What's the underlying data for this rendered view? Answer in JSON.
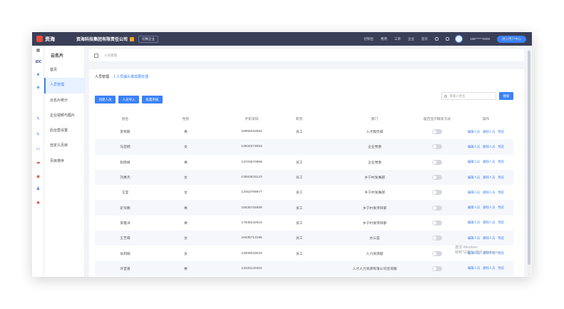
{
  "topbar": {
    "logo_text": "资海",
    "company": "资海科技集团有限责任公司",
    "switch_label": "切换企业",
    "nav": [
      "控制台",
      "费用",
      "工单",
      "企业",
      "首页"
    ],
    "phone": "188******0000",
    "user_center": "进入用户中心"
  },
  "iconbar": {
    "icons": [
      "grid-icon",
      "idc-icon",
      "e-icon",
      "diamond-icon",
      "pen-icon",
      "pen-icon",
      "monitor-icon",
      "cloud-icon",
      "target-icon",
      "person-icon",
      "star-icon"
    ],
    "idc_text": "IDC"
  },
  "subnav": {
    "title": "云名片",
    "items": [
      "首页",
      "人员管理",
      "云名片统计",
      "企业视频与图片",
      "后台签设置",
      "自定义页目",
      "页目排序"
    ],
    "active_index": 1
  },
  "breadcrumb": {
    "text": "人员管理"
  },
  "tabs": {
    "a": "人员管理",
    "b": "1.人员抽头像需要处理"
  },
  "actions": {
    "create": "创建人员",
    "import": "人员导入",
    "approve": "批量审核"
  },
  "search": {
    "placeholder": "请输入姓名",
    "button": "搜索"
  },
  "table": {
    "headers": [
      "姓名",
      "性别",
      "手机号码",
      "职务",
      "部门",
      "是否显示联系方式",
      "操作"
    ],
    "rows": [
      {
        "name": "李有毅",
        "gender": "男",
        "phone": "18955033552",
        "title": "员工",
        "dept": "人才服务部"
      },
      {
        "name": "马亚楠",
        "gender": "女",
        "phone": "13834073053",
        "title": "",
        "dept": "企业党委"
      },
      {
        "name": "张晓峰",
        "gender": "男",
        "phone": "13703570969",
        "title": "员工",
        "dept": "企业党委"
      },
      {
        "name": "刘惠杰",
        "gender": "女",
        "phone": "13593529123",
        "title": "员工",
        "dept": "乡宁村发展部"
      },
      {
        "name": "王莹",
        "gender": "女",
        "phone": "13453799877",
        "title": "员工",
        "dept": "乡宁村发展部"
      },
      {
        "name": "史华鹏",
        "gender": "男",
        "phone": "15635725689",
        "title": "员工",
        "dept": "乡宁村发项目部"
      },
      {
        "name": "李鑫洋",
        "gender": "男",
        "phone": "17635242616",
        "title": "员工",
        "dept": "乡宁村发项目部"
      },
      {
        "name": "王艺萌",
        "gender": "女",
        "phone": "15635713195",
        "title": "员工",
        "dept": "办公室"
      },
      {
        "name": "翁莉娟",
        "gender": "女",
        "phone": "13008033033",
        "title": "员工",
        "dept": "人力资源部"
      },
      {
        "name": "许首富",
        "gender": "男",
        "phone": "13333120404",
        "title": "",
        "dept": "人才人力资源有限公司咨询服"
      }
    ],
    "ops": [
      "编辑人员",
      "删除人员",
      "预览"
    ]
  },
  "watermark": {
    "line1": "激活 Windows",
    "line2": "转到\"设置\"以激活 Windows。"
  },
  "colors": {
    "topbar": "#3a3f58",
    "accent": "#3b82f6"
  }
}
